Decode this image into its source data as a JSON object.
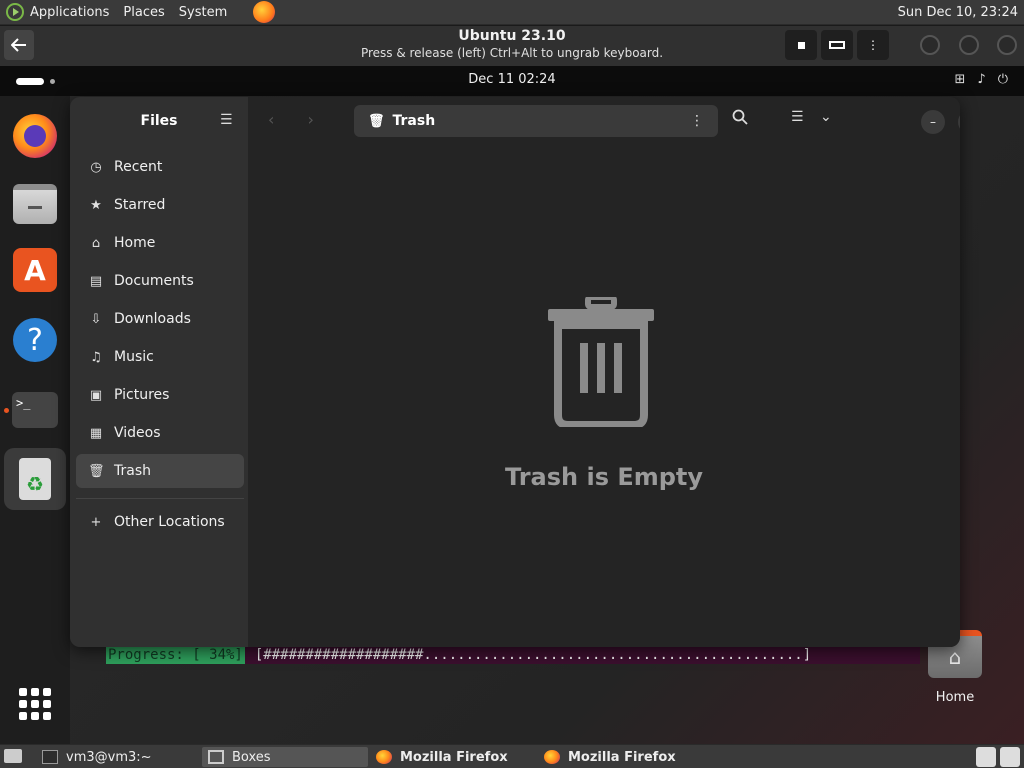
{
  "host_panel": {
    "menus": [
      "Applications",
      "Places",
      "System"
    ],
    "clock": "Sun Dec 10, 23:24"
  },
  "boxes": {
    "title": "Ubuntu 23.10",
    "subtitle": "Press & release (left) Ctrl+Alt to ungrab keyboard."
  },
  "guest_panel": {
    "datetime": "Dec 11  02:24"
  },
  "files": {
    "sidebar_title": "Files",
    "sidebar_items": [
      {
        "label": "Recent",
        "icon": "clock-icon"
      },
      {
        "label": "Starred",
        "icon": "star-icon"
      },
      {
        "label": "Home",
        "icon": "home-icon"
      },
      {
        "label": "Documents",
        "icon": "document-icon"
      },
      {
        "label": "Downloads",
        "icon": "download-icon"
      },
      {
        "label": "Music",
        "icon": "music-icon"
      },
      {
        "label": "Pictures",
        "icon": "picture-icon"
      },
      {
        "label": "Videos",
        "icon": "video-icon"
      },
      {
        "label": "Trash",
        "icon": "trash-icon"
      }
    ],
    "other_locations": "Other Locations",
    "location": "Trash",
    "empty_message": "Trash is Empty"
  },
  "terminal": {
    "progress_label": "Progress: [ 34%]",
    "progress_bar": "[###################.............................................]"
  },
  "desktop": {
    "home_label": "Home"
  },
  "taskbar": {
    "items": [
      {
        "label": "vm3@vm3:~"
      },
      {
        "label": "Boxes"
      },
      {
        "label": "Mozilla Firefox"
      },
      {
        "label": "Mozilla Firefox"
      }
    ]
  }
}
